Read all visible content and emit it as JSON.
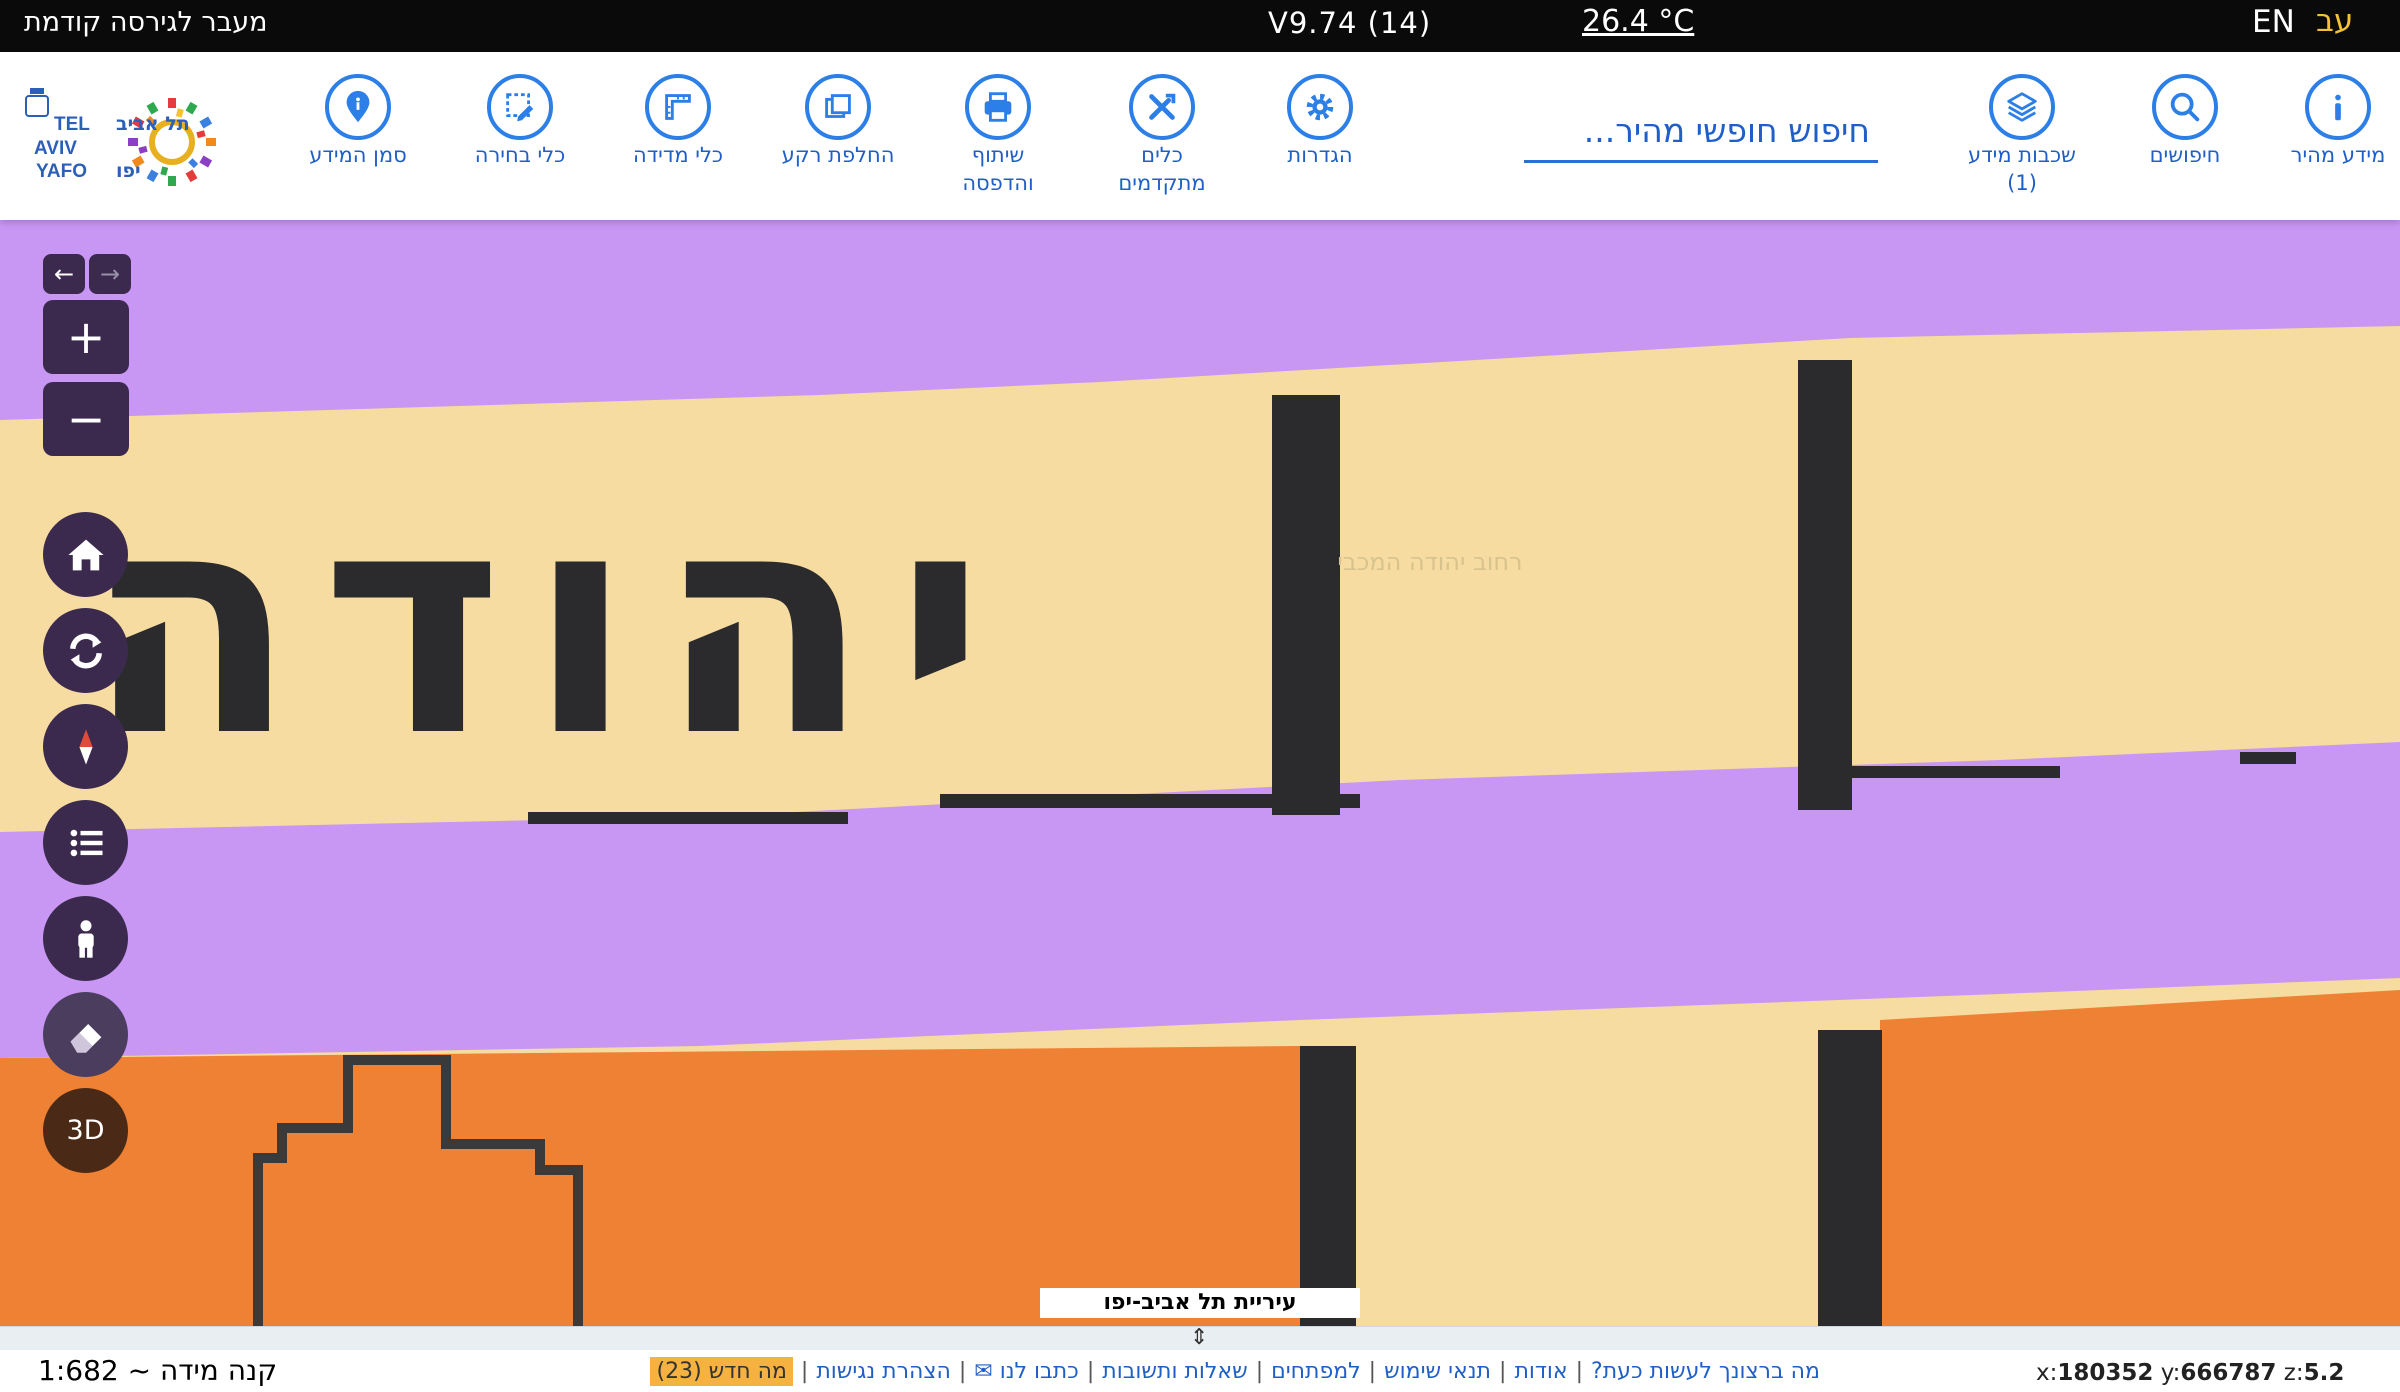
{
  "topbar": {
    "prev_version_link": "מעבר לגירסה קודמת",
    "version": "V9.74 (14)",
    "temperature": "26.4 °C",
    "lang_en": "EN",
    "lang_he": "עב"
  },
  "toolbar": {
    "quick_info": "מידע מהיר",
    "searches": "חיפושים",
    "info_layers": "שכבות מידע",
    "info_layers_count": "(1)",
    "search_placeholder": "חיפוש חופשי מהיר...",
    "settings": "הגדרות",
    "advanced_tools_1": "כלים",
    "advanced_tools_2": "מתקדמים",
    "share_print_1": "שיתוף",
    "share_print_2": "והדפסה",
    "switch_background": "החלפת רקע",
    "measure_tools": "כלי מדידה",
    "selection_tools": "כלי בחירה",
    "info_marker": "סמן המידע",
    "logo_he": "תל אביב",
    "logo_en_1": "TEL",
    "logo_en_2": "AVIV",
    "logo_en_3": "YAFO",
    "logo_he_2": "יפו"
  },
  "map": {
    "street_label_1": "רחוב יהודה המכבי",
    "street_label_2": "יהודה",
    "copyright": "עיריית תל אביב-יפו",
    "btn_3d": "3D",
    "colors": {
      "purple": "#c897f3",
      "cream": "#f6dca1",
      "orange": "#ee8133",
      "dark": "#2b2b2d",
      "control_bg": "#3b2a4e"
    }
  },
  "bottombar": {
    "scale_label": "קנה מידה ~ 1:682",
    "links": [
      "מה ברצונך לעשות כעת?",
      "אודות",
      "תנאי שימוש",
      "למפתחים",
      "שאלות ותשובות",
      "כתבו לנו ✉",
      "הצהרת נגישות"
    ],
    "whats_new": "מה חדש (23)",
    "x_label": "x:",
    "x_value": "180352",
    "y_label": "y:",
    "y_value": "666787",
    "z_label": "z:",
    "z_value": "5.2"
  }
}
